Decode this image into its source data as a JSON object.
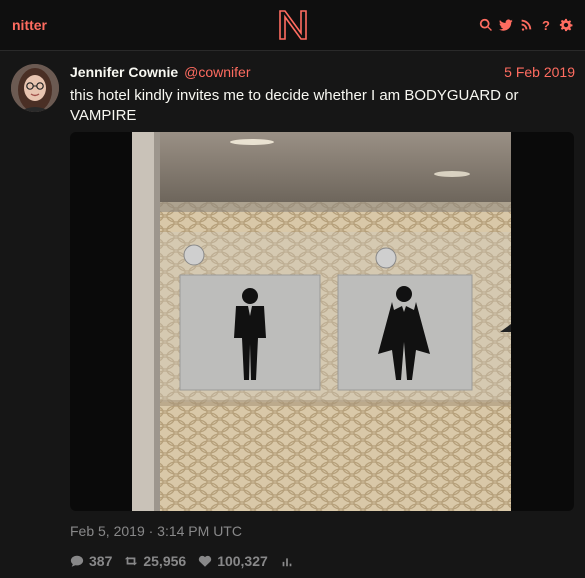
{
  "nav": {
    "brand": "nitter",
    "icons": [
      "search-icon",
      "twitter-bird-icon",
      "rss-icon",
      "help-icon",
      "gear-icon"
    ],
    "help_glyph": "?",
    "accent": "#ff6c60"
  },
  "tweet": {
    "fullname": "Jennifer Cownie",
    "username": "@cownifer",
    "date": "5 Feb 2019",
    "text": "this hotel kindly invites me to decide whether I am BODYGUARD or VAMPIRE",
    "published": "Feb 5, 2019 · 3:14 PM UTC",
    "stats": {
      "replies": "387",
      "retweets": "25,956",
      "likes": "100,327"
    }
  }
}
